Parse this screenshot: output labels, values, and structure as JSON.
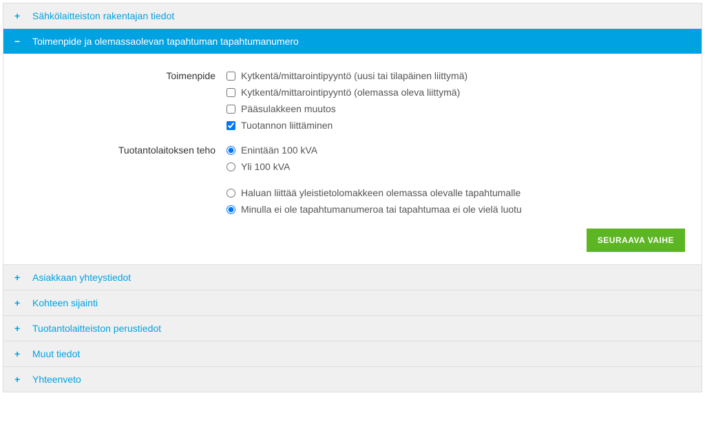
{
  "panels": {
    "builder": {
      "title": "Sähkölaitteiston rakentajan tiedot"
    },
    "procedure": {
      "title": "Toimenpide ja olemassaolevan tapahtuman tapahtumanumero"
    },
    "contact": {
      "title": "Asiakkaan yhteystiedot"
    },
    "location": {
      "title": "Kohteen sijainti"
    },
    "plant": {
      "title": "Tuotantolaitteiston perustiedot"
    },
    "other": {
      "title": "Muut tiedot"
    },
    "summary": {
      "title": "Yhteenveto"
    }
  },
  "form": {
    "toimenpide": {
      "label": "Toimenpide",
      "options": {
        "opt1": "Kytkentä/mittarointipyyntö (uusi tai tilapäinen liittymä)",
        "opt2": "Kytkentä/mittarointipyyntö (olemassa oleva liittymä)",
        "opt3": "Pääsulakkeen muutos",
        "opt4": "Tuotannon liittäminen"
      },
      "checked": {
        "opt1": false,
        "opt2": false,
        "opt3": false,
        "opt4": true
      }
    },
    "teho": {
      "label": "Tuotantolaitoksen teho",
      "options": {
        "r1": "Enintään 100 kVA",
        "r2": "Yli 100 kVA"
      },
      "selected": "r1"
    },
    "tapahtuma": {
      "options": {
        "t1": "Haluan liittää yleistietolomakkeen olemassa olevalle tapahtumalle",
        "t2": "Minulla ei ole tapahtumanumeroa tai tapahtumaa ei ole vielä luotu"
      },
      "selected": "t2"
    }
  },
  "buttons": {
    "next": "SEURAAVA VAIHE"
  },
  "icons": {
    "plus": "+",
    "minus": "−"
  }
}
